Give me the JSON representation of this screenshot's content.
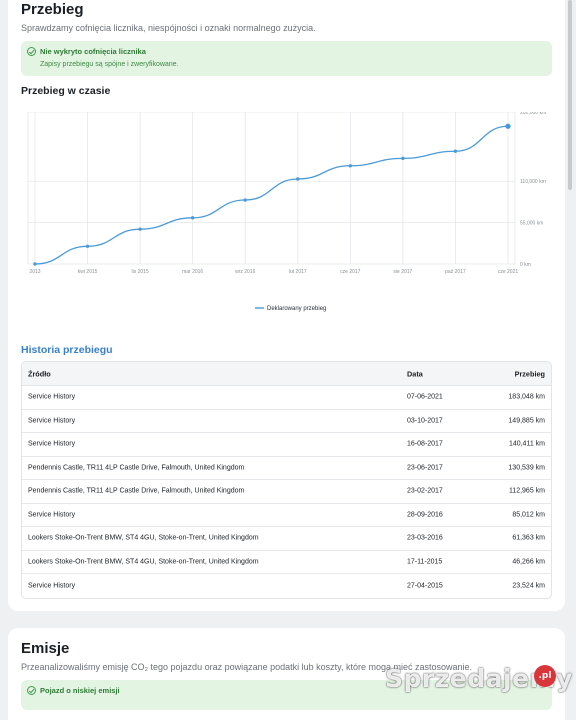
{
  "mileage_section": {
    "title": "Przebieg",
    "subtitle": "Sprawdzamy cofnięcia licznika, niespójności i oznaki normalnego zużycia.",
    "alert": {
      "title": "Nie wykryto cofnięcia licznika",
      "body": "Zapisy przebiegu są spójne i zweryfikowane.",
      "color": "#e3f4e3"
    },
    "chart_heading": "Przebieg w czasie",
    "history_heading": "Historia przebiegu"
  },
  "chart_data": {
    "type": "line",
    "title": "",
    "xlabel": "",
    "ylabel": "",
    "ylim": [
      0,
      202000
    ],
    "y_ticks": [
      "202,000 km",
      "110,000 km",
      "55,000 km",
      "0 km"
    ],
    "y_tick_values": [
      202000,
      110000,
      55000,
      0
    ],
    "x_ticks": [
      "2013",
      "kwi 2015",
      "lis 2015",
      "mar 2016",
      "wrz 2016",
      "lut 2017",
      "cze 2017",
      "sie 2017",
      "paź 2017",
      "cze 2021"
    ],
    "grid": true,
    "legend_position": "bottom-center",
    "color": "#4a9ad8",
    "series": [
      {
        "name": "Deklarowany przebieg",
        "points": [
          {
            "x_index": 0,
            "y": 0
          },
          {
            "x_index": 1,
            "y": 23524
          },
          {
            "x_index": 2,
            "y": 46266
          },
          {
            "x_index": 3,
            "y": 61363
          },
          {
            "x_index": 4,
            "y": 85012
          },
          {
            "x_index": 5,
            "y": 112965
          },
          {
            "x_index": 6,
            "y": 130539
          },
          {
            "x_index": 7,
            "y": 140411
          },
          {
            "x_index": 8,
            "y": 149885
          },
          {
            "x_index": 9,
            "y": 183048
          }
        ]
      }
    ]
  },
  "history_table": {
    "headers": {
      "source": "Źródło",
      "date": "Data",
      "mileage": "Przebieg"
    },
    "rows": [
      {
        "source": "Service History",
        "date": "07-06-2021",
        "mileage": "183,048 km"
      },
      {
        "source": "Service History",
        "date": "03-10-2017",
        "mileage": "149,885 km"
      },
      {
        "source": "Service History",
        "date": "16-08-2017",
        "mileage": "140,411 km"
      },
      {
        "source": "Pendennis Castle, TR11 4LP Castle Drive, Falmouth, United Kingdom",
        "date": "23-06-2017",
        "mileage": "130,539 km"
      },
      {
        "source": "Pendennis Castle, TR11 4LP Castle Drive, Falmouth, United Kingdom",
        "date": "23-02-2017",
        "mileage": "112,965 km"
      },
      {
        "source": "Service History",
        "date": "28-09-2016",
        "mileage": "85,012 km"
      },
      {
        "source": "Lookers Stoke-On-Trent BMW, ST4 4GU, Stoke-on-Trent, United Kingdom",
        "date": "23-03-2016",
        "mileage": "61,363 km"
      },
      {
        "source": "Lookers Stoke-On-Trent BMW, ST4 4GU, Stoke-on-Trent, United Kingdom",
        "date": "17-11-2015",
        "mileage": "46,266 km"
      },
      {
        "source": "Service History",
        "date": "27-04-2015",
        "mileage": "23,524 km"
      }
    ]
  },
  "emissions_section": {
    "title": "Emisje",
    "subtitle": "Przeanalizowaliśmy emisję CO₂ tego pojazdu oraz powiązane podatki lub koszty, które mogą mieć zastosowanie.",
    "alert": {
      "title": "Pojazd o niskiej emisji"
    }
  },
  "watermark": {
    "text": "Sprzedajemy",
    "badge": ".pl"
  }
}
